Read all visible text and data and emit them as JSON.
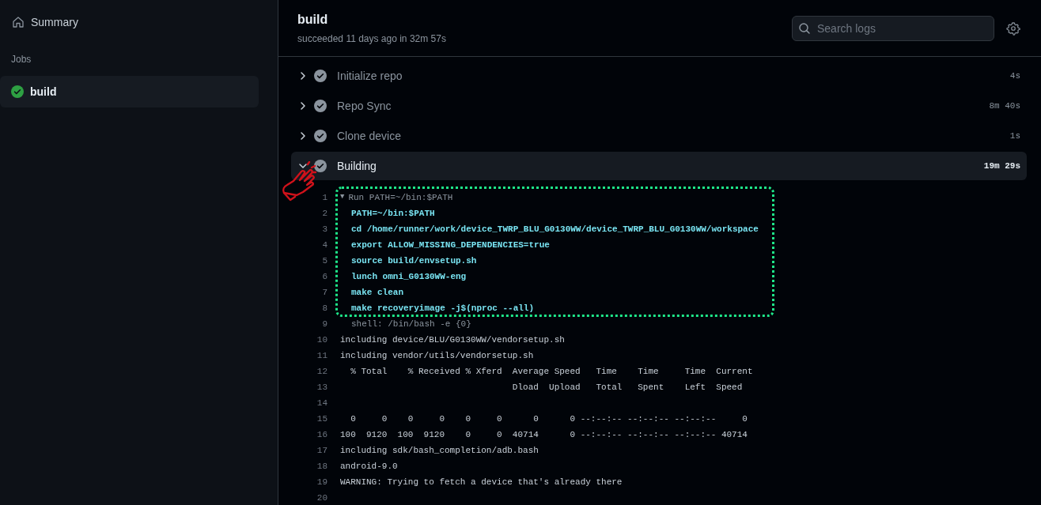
{
  "sidebar": {
    "summary": "Summary",
    "section": "Jobs",
    "jobs": [
      {
        "name": "build",
        "selected": true
      }
    ]
  },
  "header": {
    "title": "build",
    "subtitle": "succeeded 11 days ago in 32m 57s",
    "search": {
      "placeholder": "Search logs"
    }
  },
  "steps": [
    {
      "name": "Initialize repo",
      "duration": "4s",
      "expanded": false
    },
    {
      "name": "Repo Sync",
      "duration": "8m 40s",
      "expanded": false
    },
    {
      "name": "Clone device",
      "duration": "1s",
      "expanded": false
    },
    {
      "name": "Building",
      "duration": "19m 29s",
      "expanded": true
    }
  ],
  "log": [
    {
      "number": "1",
      "kind": "group",
      "text": "Run PATH=~/bin:$PATH",
      "marker": "▼"
    },
    {
      "number": "2",
      "kind": "command",
      "text": "PATH=~/bin:$PATH"
    },
    {
      "number": "3",
      "kind": "command",
      "text": "cd /home/runner/work/device_TWRP_BLU_G0130WW/device_TWRP_BLU_G0130WW/workspace"
    },
    {
      "number": "4",
      "kind": "command",
      "text": "export ALLOW_MISSING_DEPENDENCIES=true"
    },
    {
      "number": "5",
      "kind": "command",
      "text": "source build/envsetup.sh"
    },
    {
      "number": "6",
      "kind": "command",
      "text": "lunch omni_G0130WW-eng"
    },
    {
      "number": "7",
      "kind": "command",
      "text": "make clean"
    },
    {
      "number": "8",
      "kind": "command",
      "text": "make recoveryimage -j$(nproc --all)"
    },
    {
      "number": "9",
      "kind": "meta",
      "text": "shell: /bin/bash -e {0}"
    },
    {
      "number": "10",
      "kind": "plain",
      "text": "including device/BLU/G0130WW/vendorsetup.sh"
    },
    {
      "number": "11",
      "kind": "plain",
      "text": "including vendor/utils/vendorsetup.sh"
    },
    {
      "number": "12",
      "kind": "plain",
      "text": "  % Total    % Received % Xferd  Average Speed   Time    Time     Time  Current"
    },
    {
      "number": "13",
      "kind": "plain",
      "text": "                                 Dload  Upload   Total   Spent    Left  Speed"
    },
    {
      "number": "14",
      "kind": "plain"
    },
    {
      "number": "15",
      "kind": "plain",
      "text": "  0     0    0     0    0     0      0      0 --:--:-- --:--:-- --:--:--     0"
    },
    {
      "number": "16",
      "kind": "plain",
      "text": "100  9120  100  9120    0     0  40714      0 --:--:-- --:--:-- --:--:-- 40714"
    },
    {
      "number": "17",
      "kind": "plain",
      "text": "including sdk/bash_completion/adb.bash"
    },
    {
      "number": "18",
      "kind": "plain",
      "text": "android-9.0"
    },
    {
      "number": "19",
      "kind": "plain",
      "text": "WARNING: Trying to fetch a device that's already there"
    },
    {
      "number": "20",
      "kind": "plain"
    }
  ]
}
